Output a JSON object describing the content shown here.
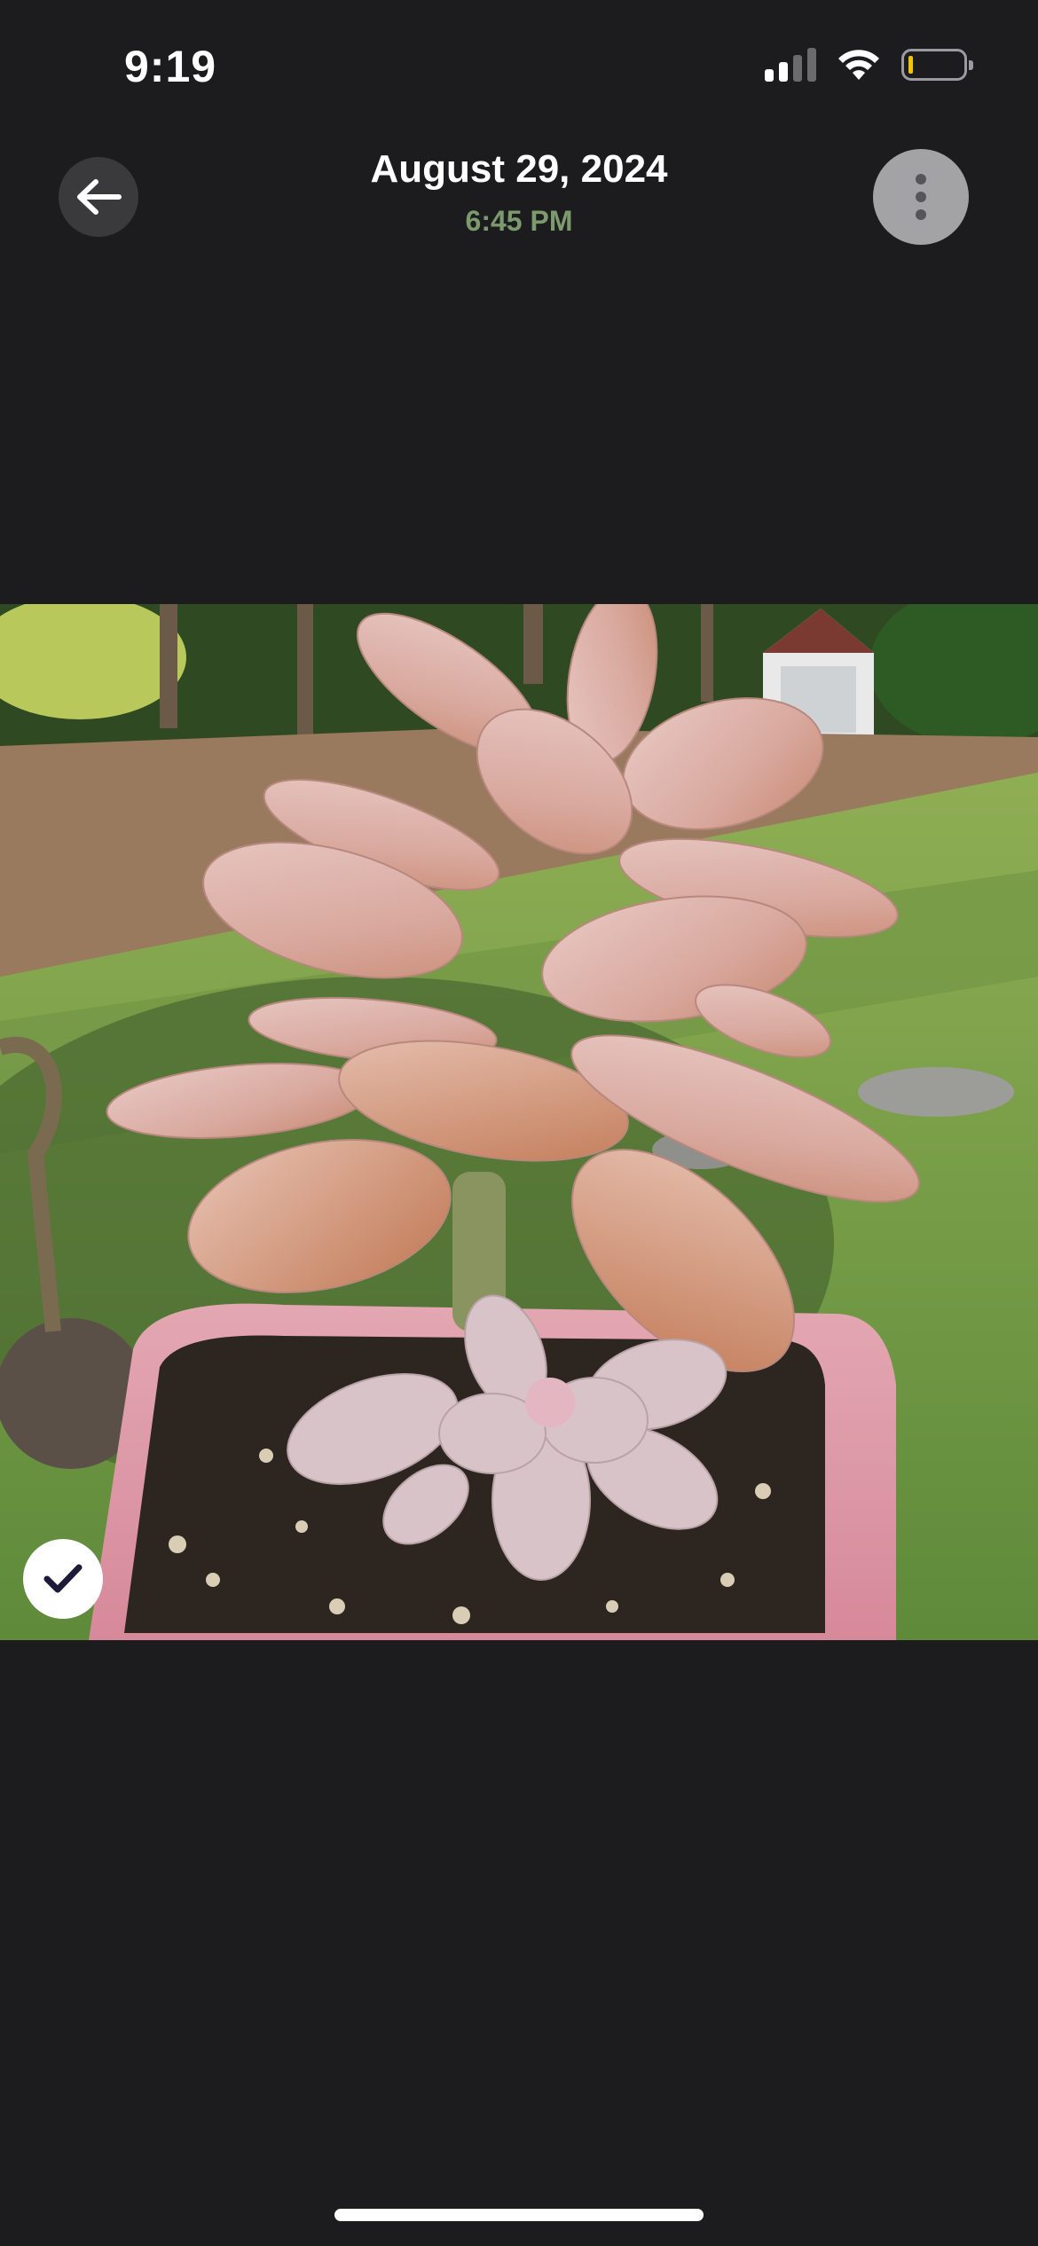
{
  "status_bar": {
    "time": "9:19",
    "icons": [
      "cellular-signal-icon",
      "wifi-icon",
      "battery-low-icon"
    ]
  },
  "header": {
    "date": "August 29, 2024",
    "time": "6:45 PM",
    "back_icon": "arrow-left-icon",
    "more_icon": "vertical-ellipsis-icon"
  },
  "photo": {
    "subject": "succulent-plant-photo",
    "selected": true
  },
  "colors": {
    "background": "#1c1c1e",
    "subtitle_green": "#7c9a6e",
    "battery_low": "#f5c400"
  }
}
